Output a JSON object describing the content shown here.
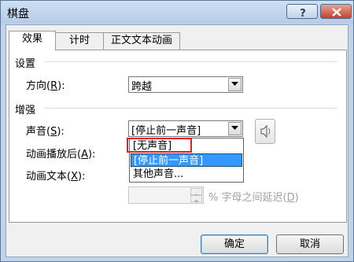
{
  "window": {
    "title": "棋盘"
  },
  "tabs": [
    {
      "label": "效果",
      "active": true
    },
    {
      "label": "计时",
      "active": false
    },
    {
      "label": "正文文本动画",
      "active": false
    }
  ],
  "settings": {
    "heading": "设置",
    "direction_label": "方向(",
    "direction_key": "R",
    "direction_suffix": "):",
    "direction_value": "跨越"
  },
  "enhance": {
    "heading": "增强",
    "sound_label": "声音(",
    "sound_key": "S",
    "sound_suffix": "):",
    "sound_value": "[停止前一声音]",
    "after_label": "动画播放后(",
    "after_key": "A",
    "after_suffix": "):",
    "text_label": "动画文本(",
    "text_key": "X",
    "text_suffix": "):",
    "delay_label": "% 字母之间延迟(",
    "delay_key": "D",
    "delay_suffix": ")"
  },
  "sound_options": [
    "[无声音]",
    "[停止前一声音]",
    "其他声音..."
  ],
  "buttons": {
    "ok": "确定",
    "cancel": "取消"
  },
  "colors": {
    "selection": "#3399ff",
    "highlight_box": "#e02020"
  }
}
